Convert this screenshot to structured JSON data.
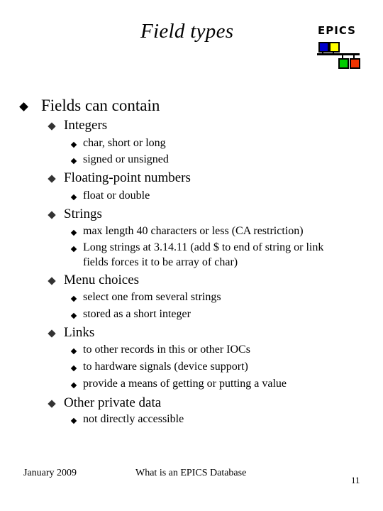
{
  "slide": {
    "title": "Field types",
    "logo": {
      "text": "EPICS",
      "squares": [
        "#0000cc",
        "#ffff00",
        "#00cc00",
        "#ee3300"
      ]
    },
    "bullets": [
      {
        "level": 1,
        "text": "Fields can contain"
      },
      {
        "level": 2,
        "text": "Integers"
      },
      {
        "level": 3,
        "text": "char, short or long"
      },
      {
        "level": 3,
        "text": "signed or unsigned"
      },
      {
        "level": 2,
        "text": "Floating-point numbers"
      },
      {
        "level": 3,
        "text": "float or double"
      },
      {
        "level": 2,
        "text": "Strings"
      },
      {
        "level": 3,
        "text": "max length 40 characters or less (CA restriction)"
      },
      {
        "level": 3,
        "text": "Long strings at 3.14.11 (add $ to end of string or link"
      },
      {
        "level": 0,
        "text": "fields forces it to be array of char)"
      },
      {
        "level": 2,
        "text": "Menu choices"
      },
      {
        "level": 3,
        "text": "select one from several strings"
      },
      {
        "level": 3,
        "text": "stored as a short integer"
      },
      {
        "level": 2,
        "text": "Links"
      },
      {
        "level": 3,
        "text": "to other records in this or other IOCs"
      },
      {
        "level": 3,
        "text": "to hardware signals (device support)"
      },
      {
        "level": 3,
        "text": "provide a means of getting or putting a value"
      },
      {
        "level": 2,
        "text": "Other private data"
      },
      {
        "level": 3,
        "text": "not directly accessible"
      }
    ],
    "footer": {
      "date": "January 2009",
      "center": "What is an EPICS Database",
      "page": "11"
    }
  }
}
